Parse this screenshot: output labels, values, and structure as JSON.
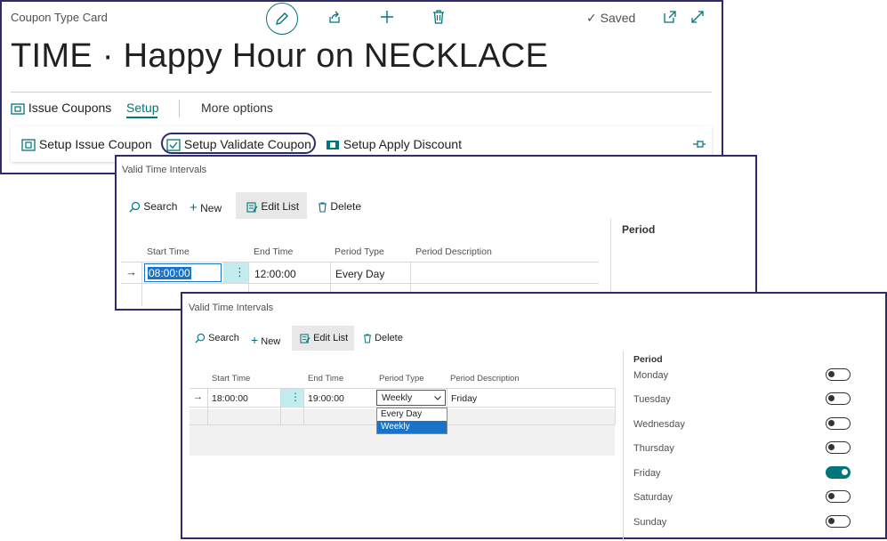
{
  "card": {
    "subtitle": "Coupon Type Card",
    "title": "TIME · Happy Hour on NECKLACE",
    "saved_label": "Saved",
    "actions": {
      "issue_coupons": "Issue Coupons",
      "setup": "Setup",
      "more_options": "More options"
    },
    "setup_actions": {
      "issue": "Setup Issue Coupon",
      "validate": "Setup Validate Coupon",
      "apply": "Setup Apply Discount"
    },
    "accent_color": "#00757a"
  },
  "panel1": {
    "title": "Valid Time Intervals",
    "toolbar": {
      "search": "Search",
      "new": "New",
      "edit_list": "Edit List",
      "delete": "Delete"
    },
    "columns": {
      "start": "Start Time",
      "end": "End Time",
      "type": "Period Type",
      "desc": "Period Description"
    },
    "rows": [
      {
        "start": "08:00:00",
        "end": "12:00:00",
        "type": "Every Day",
        "desc": ""
      }
    ],
    "factbox_title": "Period"
  },
  "panel2": {
    "title": "Valid Time Intervals",
    "toolbar": {
      "search": "Search",
      "new": "New",
      "edit_list": "Edit List",
      "delete": "Delete"
    },
    "columns": {
      "start": "Start Time",
      "end": "End Time",
      "type": "Period Type",
      "desc": "Period Description"
    },
    "rows": [
      {
        "start": "18:00:00",
        "end": "19:00:00",
        "type": "Weekly",
        "desc": "Friday"
      }
    ],
    "dropdown_options": [
      "Every Day",
      "Weekly"
    ],
    "factbox": {
      "title": "Period",
      "days": [
        {
          "label": "Monday",
          "on": false
        },
        {
          "label": "Tuesday",
          "on": false
        },
        {
          "label": "Wednesday",
          "on": false
        },
        {
          "label": "Thursday",
          "on": false
        },
        {
          "label": "Friday",
          "on": true
        },
        {
          "label": "Saturday",
          "on": false
        },
        {
          "label": "Sunday",
          "on": false
        }
      ]
    }
  }
}
